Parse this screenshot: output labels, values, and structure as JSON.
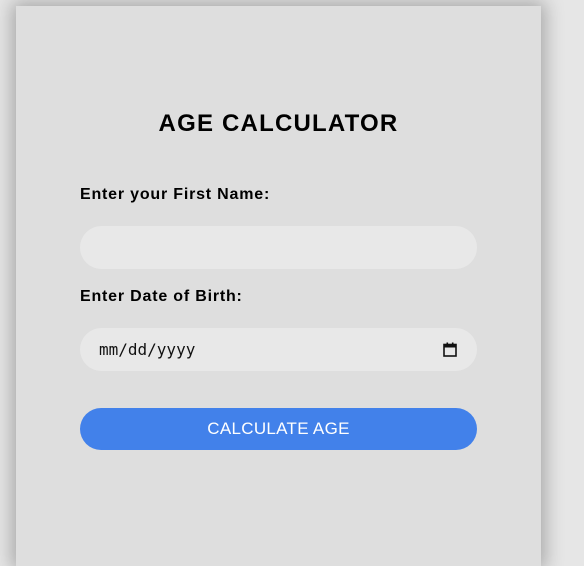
{
  "form": {
    "title": "AGE CALCULATOR",
    "first_name_label": "Enter your First Name:",
    "first_name_value": "",
    "dob_label": "Enter Date of Birth:",
    "dob_placeholder": "mm/dd/yyyy",
    "dob_icon": "calendar-icon",
    "calculate_label": "CALCULATE AGE"
  },
  "colors": {
    "page_background": "#e6e6e6",
    "card_background": "#dedede",
    "input_background": "#e8e8e8",
    "button_background": "#4281ea",
    "button_text": "#ffffff"
  }
}
